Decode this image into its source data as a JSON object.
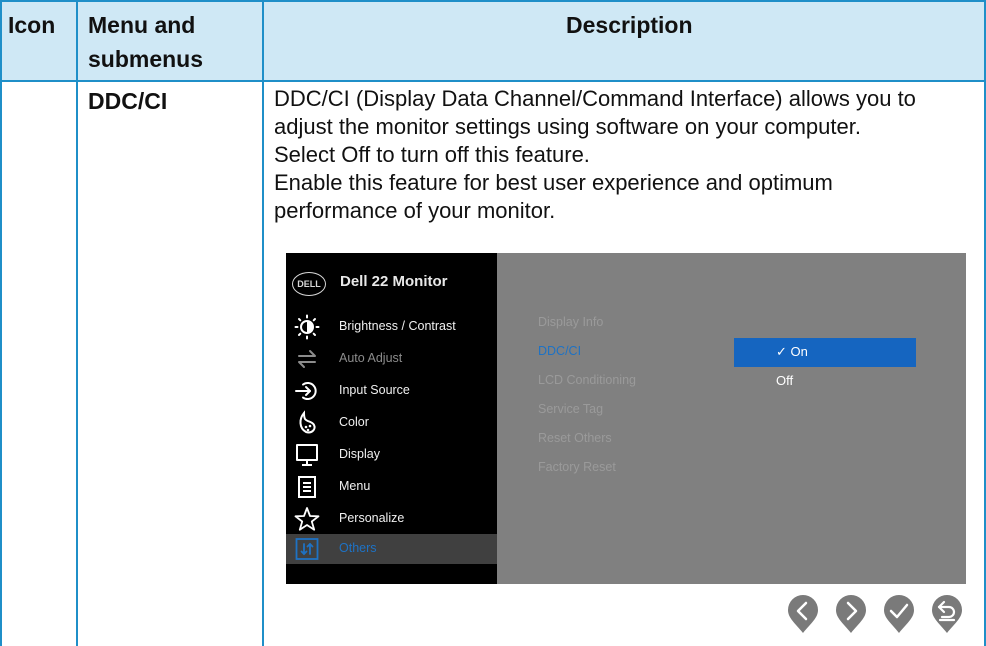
{
  "header": {
    "icon": "Icon",
    "menu_line1": "Menu and",
    "menu_line2": "submenus",
    "description": "Description"
  },
  "row": {
    "menu": "DDC/CI",
    "description_lines": [
      "DDC/CI (Display Data Channel/Command Interface) allows you to",
      "adjust the monitor settings using software on your computer.",
      "Select Off to turn off this feature.",
      "Enable this feature for best user experience and optimum",
      "performance of your monitor."
    ]
  },
  "osd": {
    "brand_logo": "DELL",
    "title": "Dell 22 Monitor",
    "menu_items": [
      {
        "label": "Brightness / Contrast",
        "icon": "brightness-icon"
      },
      {
        "label": "Auto Adjust",
        "icon": "auto-adjust-icon"
      },
      {
        "label": "Input Source",
        "icon": "input-source-icon"
      },
      {
        "label": "Color",
        "icon": "color-icon"
      },
      {
        "label": "Display",
        "icon": "display-icon"
      },
      {
        "label": "Menu",
        "icon": "menu-icon"
      },
      {
        "label": "Personalize",
        "icon": "star-icon"
      },
      {
        "label": "Others",
        "icon": "others-icon"
      }
    ],
    "submenu": [
      "Display Info",
      "DDC/CI",
      "LCD Conditioning",
      "Service Tag",
      "Reset Others",
      "Factory Reset"
    ],
    "options": {
      "check": "✓",
      "on": "On",
      "off": "Off"
    },
    "buttons": [
      "left-arrow-icon",
      "right-arrow-icon",
      "check-icon",
      "exit-icon"
    ],
    "colors": {
      "highlight": "#1565c0",
      "selected_text": "#1e72c4",
      "panel": "#808080",
      "button": "#7a7a7a"
    }
  },
  "colors": {
    "table_line": "#1f8fc8",
    "header_bg": "#cfe8f5"
  }
}
